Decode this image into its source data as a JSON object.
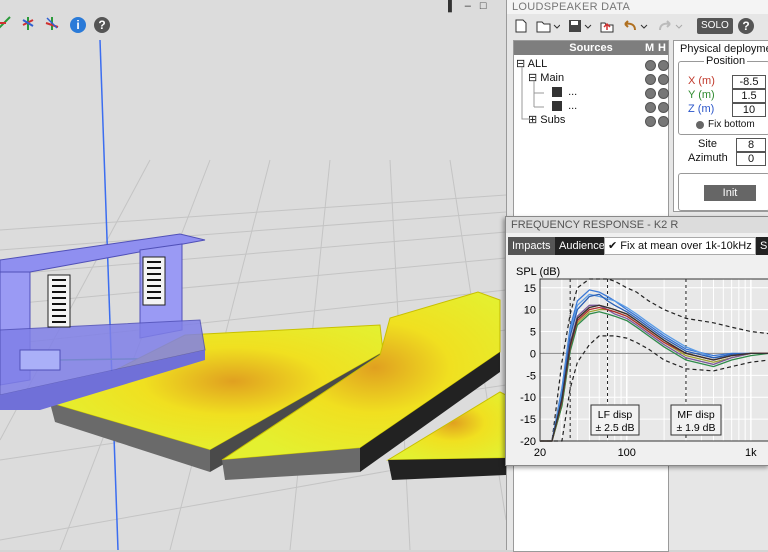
{
  "viewport": {
    "toolbar_icons": [
      "axis-tool-icon",
      "rotate-tool-icon",
      "move-tool-icon",
      "info-icon",
      "help-icon"
    ],
    "info_glyph": "i",
    "help_glyph": "?",
    "window_controls": {
      "pin": "▌",
      "minimize": "–",
      "maximize": "□"
    }
  },
  "loudspeaker": {
    "title": "LOUDSPEAKER DATA",
    "toolbar": {
      "solo_label": "SOLO",
      "help_glyph": "?"
    },
    "sources": {
      "header": "Sources",
      "col_m": "M",
      "col_h": "H",
      "tree": [
        {
          "label": "ALL",
          "expander": "⊟"
        },
        {
          "label": "Main",
          "expander": "⊟"
        },
        {
          "label": "...",
          "expander": ""
        },
        {
          "label": "...",
          "expander": ""
        },
        {
          "label": "Subs",
          "expander": "⊞"
        }
      ]
    },
    "physical": {
      "tab_label": "Physical deployment",
      "position_label": "Position",
      "x_label": "X (m)",
      "x_value": "-8.5",
      "y_label": "Y (m)",
      "y_value": "1.5",
      "z_label": "Z (m)",
      "z_value": "10",
      "fix_bottom_label": "Fix bottom",
      "site_label": "Site",
      "site_value": "8",
      "azimuth_label": "Azimuth",
      "azimuth_value": "0",
      "init_label": "Init"
    },
    "colors": {
      "x": "#c0392b",
      "y": "#2e8b2e",
      "z": "#2a55c9"
    }
  },
  "freq": {
    "title": "FREQUENCY RESPONSE - K2 R",
    "impacts_label": "Impacts",
    "audience_label": "Audience",
    "check_glyph": "✔",
    "fix_label": "Fix at mean over 1k-10kHz",
    "extra_label": "Sh",
    "lf_disp_label": "LF disp",
    "lf_disp_value": "± 2.5 dB",
    "mf_disp_label": "MF disp",
    "mf_disp_value": "± 1.9 dB"
  },
  "chart_data": {
    "type": "line",
    "ylabel": "SPL (dB)",
    "ylim": [
      -20,
      17
    ],
    "xlim": [
      20,
      1400
    ],
    "x_scale": "log",
    "yticks": [
      15,
      10,
      5,
      0,
      -5,
      -10,
      -15,
      -20
    ],
    "xticks": [
      {
        "value": 20,
        "label": "20"
      },
      {
        "value": 100,
        "label": "100"
      },
      {
        "value": 1000,
        "label": "1k"
      }
    ],
    "grid": true,
    "x": [
      20,
      25,
      30,
      35,
      40,
      50,
      60,
      70,
      80,
      100,
      120,
      150,
      200,
      300,
      500,
      700,
      1000,
      1400
    ],
    "series": [
      {
        "color": "#3a78d6",
        "values": [
          -20,
          -20,
          -8,
          6,
          12,
          14.5,
          14,
          13,
          12,
          10,
          8.5,
          6.5,
          4,
          1,
          -0.5,
          0,
          0,
          0
        ]
      },
      {
        "color": "#5a9be6",
        "values": [
          -20,
          -20,
          -9,
          5,
          11,
          13.5,
          13,
          12.5,
          12,
          10.5,
          9,
          7,
          4.5,
          1.5,
          -1,
          -0.5,
          0,
          0
        ]
      },
      {
        "color": "#2b5fb3",
        "values": [
          -20,
          -20,
          -10,
          4,
          10,
          13,
          13.5,
          12,
          11,
          9.5,
          8,
          6,
          3.5,
          0.5,
          -1,
          -0.2,
          0,
          0
        ]
      },
      {
        "color": "#d07a3a",
        "values": [
          -20,
          -20,
          -11,
          2,
          8,
          10.5,
          11,
          10.5,
          10,
          9,
          7.5,
          5.5,
          3,
          0,
          -1.5,
          -0.5,
          0,
          0
        ]
      },
      {
        "color": "#a0a030",
        "values": [
          -20,
          -20,
          -12,
          1,
          7,
          9.5,
          10,
          10,
          9.5,
          8.5,
          7,
          5,
          2.5,
          -0.5,
          -2,
          -1,
          0,
          0
        ]
      },
      {
        "color": "#7a5a9a",
        "values": [
          -20,
          -20,
          -11,
          2.5,
          8.5,
          11,
          11,
          10,
          9,
          8,
          6.5,
          4.5,
          2,
          -1,
          -2.5,
          -1,
          0,
          0
        ]
      },
      {
        "color": "#2e8a4a",
        "values": [
          -20,
          -20,
          -12,
          0.5,
          6.5,
          9,
          9.5,
          9,
          8.5,
          7.5,
          6,
          4,
          1.5,
          -1.5,
          -3,
          -1.5,
          -0.5,
          0
        ]
      },
      {
        "color": "#b03030",
        "values": [
          -20,
          -20,
          -11,
          1.5,
          7.5,
          10,
          10.5,
          10,
          9.5,
          8.5,
          7,
          5,
          2.5,
          0,
          -1.5,
          -0.5,
          0,
          0
        ]
      },
      {
        "color": "#333333",
        "values": [
          -20,
          -20,
          -10.5,
          2,
          8,
          10.5,
          11,
          10.5,
          10,
          9,
          7.5,
          5.5,
          3,
          0,
          -1.5,
          -0.5,
          0,
          0
        ]
      }
    ],
    "envelope_upper": [
      -20,
      -20,
      -2,
      9,
      15,
      17.5,
      17.5,
      17,
      16.5,
      15,
      14,
      12,
      10,
      8,
      7,
      6,
      5,
      4.5
    ],
    "envelope_lower": [
      -20,
      -20,
      -20,
      -8,
      -2,
      2,
      4,
      4,
      4,
      3.5,
      2.5,
      1,
      -1.5,
      -3.5,
      -4,
      -3,
      -2,
      -1.5
    ]
  }
}
